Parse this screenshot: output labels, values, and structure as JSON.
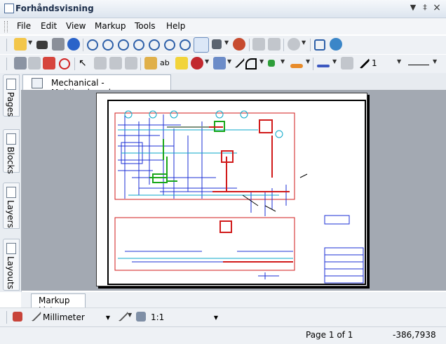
{
  "window": {
    "title": "Forhåndsvisning",
    "pin_glyph": "▼",
    "dock_glyph": "‡",
    "close_glyph": "×"
  },
  "menu": [
    "File",
    "Edit",
    "View",
    "Markup",
    "Tools",
    "Help"
  ],
  "toolbar2": {
    "line_width_value": "1"
  },
  "side_tabs": [
    "Pages",
    "Blocks",
    "Layers",
    "Layouts"
  ],
  "document_tab": {
    "label": "Mechanical - Multileaders.dwg"
  },
  "markup_list_tab": {
    "label": "Markup List"
  },
  "bottom_toolbar": {
    "units_value": "Millimeter",
    "scale_value": "1:1"
  },
  "status": {
    "page": "Page 1 of 1",
    "coordinate": "-386,7938"
  },
  "colors": {
    "viewer_bg": "#a3a9b2",
    "drawing_red": "#d11a1a",
    "drawing_blue": "#1b2fd6",
    "drawing_green": "#19a719",
    "drawing_cyan": "#0aa7c9"
  }
}
